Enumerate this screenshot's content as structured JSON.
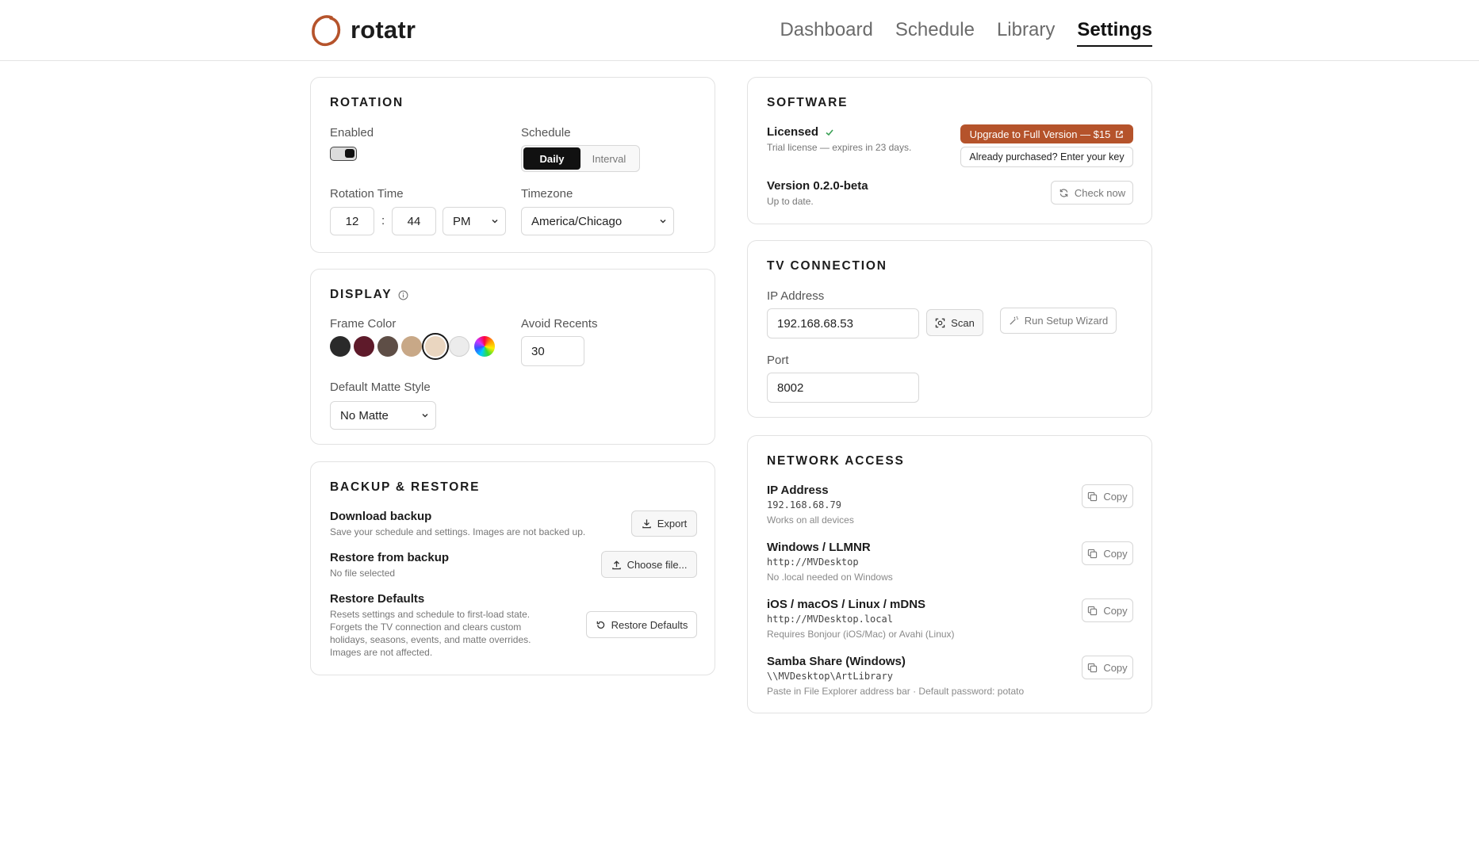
{
  "app": {
    "name": "rotatr"
  },
  "colors": {
    "accent": "#b5532b",
    "text": "#1c1c1c",
    "border": "#e2e2e2"
  },
  "nav": {
    "items": [
      "Dashboard",
      "Schedule",
      "Library",
      "Settings"
    ],
    "active": "Settings"
  },
  "rotation": {
    "title": "ROTATION",
    "enabled_label": "Enabled",
    "enabled": true,
    "schedule_label": "Schedule",
    "schedule_options": [
      "Daily",
      "Interval"
    ],
    "schedule_selected": "Daily",
    "rotation_time_label": "Rotation Time",
    "hour": "12",
    "time_sep": ":",
    "minute": "44",
    "ampm": "PM",
    "timezone_label": "Timezone",
    "timezone": "America/Chicago"
  },
  "display": {
    "title": "DISPLAY",
    "info_icon": "info-icon",
    "frame_color_label": "Frame Color",
    "swatches": [
      "#2a2a2a",
      "#5e1a2a",
      "#5e4e46",
      "#c8a887",
      "#ead6c0",
      "#ececec"
    ],
    "selected_swatch_index": 4,
    "avoid_recents_label": "Avoid Recents",
    "avoid_recents": "30",
    "matte_label": "Default Matte Style",
    "matte": "No Matte"
  },
  "backup": {
    "title": "BACKUP & RESTORE",
    "download_title": "Download backup",
    "download_desc": "Save your schedule and settings. Images are not backed up.",
    "export_label": "Export",
    "restore_title": "Restore from backup",
    "restore_desc": "No file selected",
    "choose_label": "Choose file...",
    "defaults_title": "Restore Defaults",
    "defaults_desc": [
      "Resets settings and schedule to first-load state.",
      "Forgets the TV connection and clears custom",
      "holidays, seasons, events, and matte overrides.",
      "Images are not affected."
    ],
    "defaults_button": "Restore Defaults"
  },
  "software": {
    "title": "SOFTWARE",
    "license_title": "Licensed",
    "license_desc": "Trial license — expires in 23 days.",
    "upgrade_label": "Upgrade to Full Version — $15",
    "key_label": "Already purchased? Enter your key",
    "version_title": "Version 0.2.0-beta",
    "version_desc": "Up to date.",
    "check_label": "Check now"
  },
  "tv": {
    "title": "TV CONNECTION",
    "ip_label": "IP Address",
    "ip": "192.168.68.53",
    "scan_label": "Scan",
    "wizard_label": "Run Setup Wizard",
    "port_label": "Port",
    "port": "8002"
  },
  "network": {
    "title": "NETWORK ACCESS",
    "copy_label": "Copy",
    "items": [
      {
        "title": "IP Address",
        "value": "192.168.68.79",
        "note": "Works on all devices"
      },
      {
        "title": "Windows / LLMNR",
        "value": "http://MVDesktop",
        "note": "No .local needed on Windows"
      },
      {
        "title": "iOS / macOS / Linux / mDNS",
        "value": "http://MVDesktop.local",
        "note": "Requires Bonjour (iOS/Mac) or Avahi (Linux)"
      },
      {
        "title": "Samba Share (Windows)",
        "value": "\\\\MVDesktop\\ArtLibrary",
        "note": "Paste in File Explorer address bar · Default password: potato"
      }
    ]
  }
}
